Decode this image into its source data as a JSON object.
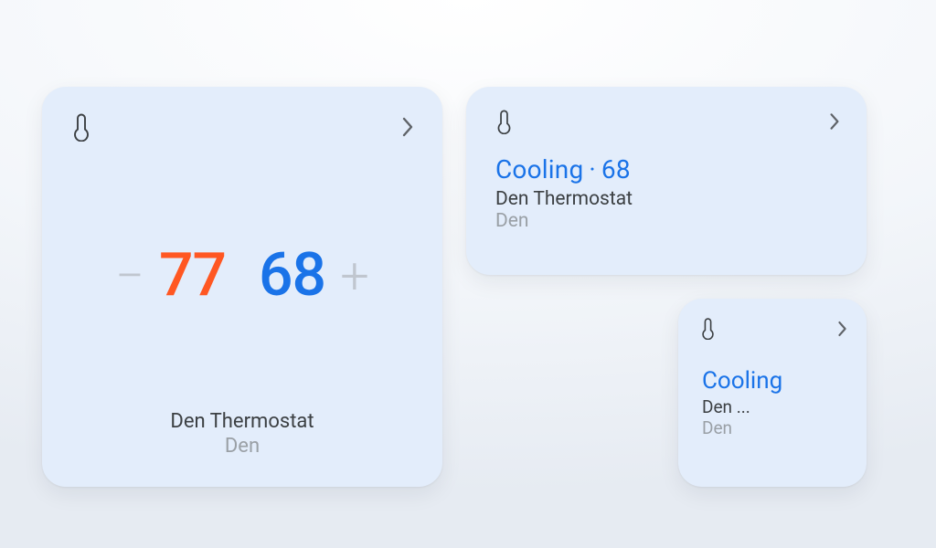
{
  "colors": {
    "card_bg": "#e3edfb",
    "heat": "#ff5722",
    "cool": "#1a73e8",
    "muted": "#9aa0a6",
    "text": "#3c4043",
    "icon": "#3c4043",
    "pm": "#c0c6cf"
  },
  "card1": {
    "heat_temp": "77",
    "cool_temp": "68",
    "minus": "−",
    "plus": "+",
    "device_name": "Den Thermostat",
    "room": "Den"
  },
  "card2": {
    "status": "Cooling",
    "sep": "·",
    "setpoint": "68",
    "device_name": "Den Thermostat",
    "room": "Den"
  },
  "card3": {
    "status": "Cooling",
    "device_name_trunc": "Den ...",
    "room": "Den"
  },
  "icons": {
    "thermometer": "thermometer-icon",
    "chevron_right": "chevron-right-icon",
    "minus": "minus-icon",
    "plus": "plus-icon"
  }
}
